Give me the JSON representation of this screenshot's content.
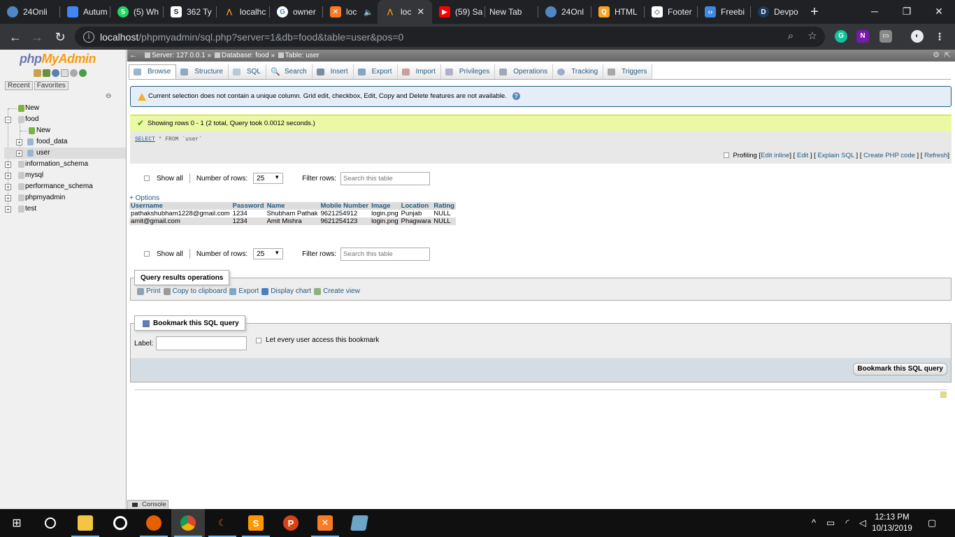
{
  "browser": {
    "tabs": [
      {
        "label": "24Onli",
        "icon": "cloud-icon",
        "color": "#4e88c7"
      },
      {
        "label": "Autum",
        "icon": "doc-icon",
        "color": "#4285f4"
      },
      {
        "label": "(5) Wh",
        "icon": "whatsapp-icon",
        "color": "#25d366"
      },
      {
        "label": "362 Ty",
        "icon": "s-icon",
        "color": "#ffffff"
      },
      {
        "label": "localhc",
        "icon": "pma-icon",
        "color": "#f89c0e"
      },
      {
        "label": "owner",
        "icon": "google-icon",
        "color": "#ffffff"
      },
      {
        "label": "loc",
        "icon": "xampp-icon",
        "color": "#fb7a24"
      },
      {
        "label": "loc",
        "icon": "pma-icon",
        "color": "#f89c0e"
      },
      {
        "label": "(59) Sa",
        "icon": "youtube-icon",
        "color": "#ff0000"
      },
      {
        "label": "New Tab",
        "icon": "",
        "color": ""
      },
      {
        "label": "24Onl",
        "icon": "cloud-icon",
        "color": "#4e88c7"
      },
      {
        "label": "HTML",
        "icon": "html-icon",
        "color": "#f5a623"
      },
      {
        "label": "Footer",
        "icon": "codepen-icon",
        "color": "#ffffff"
      },
      {
        "label": "Freebi",
        "icon": "code-icon",
        "color": "#3c8ae2"
      },
      {
        "label": "Devpo",
        "icon": "d-icon",
        "color": "#1e3a5f"
      }
    ],
    "url_host": "localhost",
    "url_rest": "/phpmyadmin/sql.php?server=1&db=food&table=user&pos=0"
  },
  "sidebar": {
    "logo_php": "php",
    "logo_my": "MyAdmin",
    "recent": "Recent",
    "favorites": "Favorites",
    "tree": [
      {
        "label": "New",
        "level": 0
      },
      {
        "label": "food",
        "level": 0
      },
      {
        "label": "New",
        "level": 1
      },
      {
        "label": "food_data",
        "level": 1
      },
      {
        "label": "user",
        "level": 1
      },
      {
        "label": "information_schema",
        "level": 0
      },
      {
        "label": "mysql",
        "level": 0
      },
      {
        "label": "performance_schema",
        "level": 0
      },
      {
        "label": "phpmyadmin",
        "level": 0
      },
      {
        "label": "test",
        "level": 0
      }
    ]
  },
  "breadcrumb": {
    "server": "Server: 127.0.0.1",
    "database": "Database: food",
    "table": "Table: user",
    "sep": "»"
  },
  "menu": [
    "Browse",
    "Structure",
    "SQL",
    "Search",
    "Insert",
    "Export",
    "Import",
    "Privileges",
    "Operations",
    "Tracking",
    "Triggers"
  ],
  "notice": "Current selection does not contain a unique column. Grid edit, checkbox, Edit, Copy and Delete features are not available.",
  "success": "Showing rows 0 - 1 (2 total, Query took 0.0012 seconds.)",
  "sql": {
    "kw": "SELECT",
    "star": " * ",
    "rest": "FROM `user`"
  },
  "sql_links": {
    "profiling": "Profiling",
    "edit_inline": "Edit inline",
    "edit": "Edit",
    "explain": "Explain SQL",
    "php_code": "Create PHP code",
    "refresh": "Refresh"
  },
  "nav": {
    "show_all": "Show all",
    "num_rows": "Number of rows:",
    "rows_value": "25",
    "filter": "Filter rows:",
    "placeholder": "Search this table"
  },
  "options": "+ Options",
  "table": {
    "columns": [
      "Username",
      "Password",
      "Name",
      "Mobile Number",
      "Image",
      "Location",
      "Rating"
    ],
    "rows": [
      [
        "pathakshubham1228@gmail.com",
        "1234",
        "Shubham Pathak",
        "9621254912",
        "login.png",
        "Punjab",
        "NULL"
      ],
      [
        "amit@gmail.com",
        "1234",
        "Amit Mishra",
        "9621254123",
        "login.png",
        "Phagwara",
        "NULL"
      ]
    ]
  },
  "ops": {
    "legend": "Query results operations",
    "print": "Print",
    "copy": "Copy to clipboard",
    "export": "Export",
    "chart": "Display chart",
    "view": "Create view"
  },
  "bookmark": {
    "legend": "Bookmark this SQL query",
    "label": "Label:",
    "every_user": "Let every user access this bookmark",
    "button": "Bookmark this SQL query"
  },
  "console": "Console",
  "clock": {
    "time": "12:13 PM",
    "date": "10/13/2019"
  }
}
